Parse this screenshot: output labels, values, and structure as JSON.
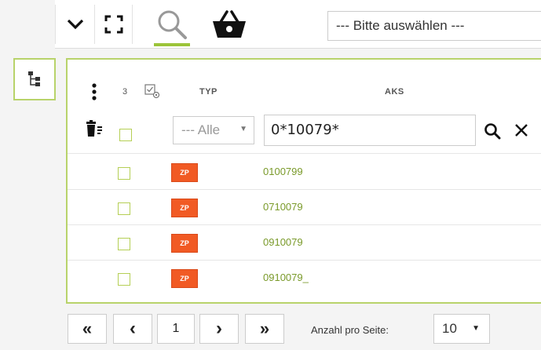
{
  "toolbar": {
    "category_select": {
      "value": "--- Bitte auswählen ---"
    }
  },
  "table": {
    "selected_count": "3",
    "columns": {
      "typ": "TYP",
      "aks": "AKS"
    },
    "filter": {
      "type_value": "--- Alle",
      "aks_value": "0*10079*"
    },
    "rows": [
      {
        "badge": "ZP",
        "aks": "0100799"
      },
      {
        "badge": "ZP",
        "aks": "0710079"
      },
      {
        "badge": "ZP",
        "aks": "0910079"
      },
      {
        "badge": "ZP",
        "aks": "0910079_"
      }
    ]
  },
  "pagination": {
    "first": "«",
    "prev": "‹",
    "current_page": "1",
    "next": "›",
    "last": "»",
    "per_page_label": "Anzahl pro Seite:",
    "per_page_value": "10"
  },
  "colors": {
    "accent_green": "#9cc43a",
    "badge_orange": "#f15a24",
    "link_green": "#7a9a2a"
  }
}
